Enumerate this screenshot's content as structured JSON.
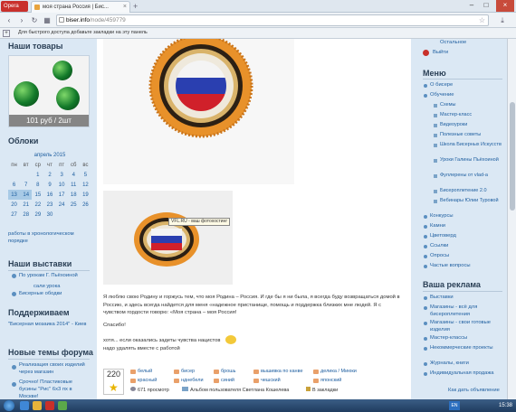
{
  "browser": {
    "opera_label": "Opera",
    "tab_title": "моя страна Россия | Бис...",
    "url_host": "biser.info",
    "url_path": "/node/459779",
    "bookmarks_hint": "Для быстрого доступа добавьте закладки на эту панель"
  },
  "left": {
    "products_title": "Наши товары",
    "product_price": "101 руб / 2шт",
    "calendar_title": "Облоки",
    "calendar_month": "апрель 2015",
    "calendar_days": [
      "пн",
      "вт",
      "ср",
      "чт",
      "пт",
      "сб",
      "вс"
    ],
    "calendar_rows": [
      [
        "",
        "",
        "1",
        "2",
        "3",
        "4",
        "5"
      ],
      [
        "6",
        "7",
        "8",
        "9",
        "10",
        "11",
        "12"
      ],
      [
        "13",
        "14",
        "15",
        "16",
        "17",
        "18",
        "19"
      ],
      [
        "20",
        "21",
        "22",
        "23",
        "24",
        "25",
        "26"
      ],
      [
        "27",
        "28",
        "29",
        "30",
        "",
        "",
        ""
      ]
    ],
    "calendar_link": "работы в хронологическом порядке",
    "exhibitions_title": "Наши выставки",
    "exhibitions": [
      "По урокам Г. Пьёхоиной",
      "сали урока",
      "Бисерные ободки"
    ],
    "support_title": "Поддерживаем",
    "support_text": "\"Бисерная мозаика 2014\" - Киев",
    "forum_title": "Новые темы форума",
    "forum_items": [
      "Реализация своих изделий через магазин",
      "Срочно! Пластиковые бусины \"Рис\" 6х3 пх в Москве!"
    ]
  },
  "main": {
    "tooltip": "VFL.RU - ваш фотохостинг",
    "paragraph1": "Я люблю свою Родину и горжусь тем, что моя Родина – Россия. И где бы я ни была, я всегда буду возвращаться домой в Россию, и здесь всегда найдется для меня «надежное пристанище, помощь и поддержка близких мне людей. Я с чувством гордости говорю: «Моя страна – моя Россия!",
    "paragraph2": "Спасибо!",
    "paragraph3": "хотя... если оказались задеты чувства нацистов",
    "paragraph4": "надо удалять вместе с работой",
    "counter": "220",
    "tags_row1": [
      "белый",
      "бисер",
      "брошь",
      "вышивка по канве",
      "делика / Миюки"
    ],
    "tags_row2": [
      "красный",
      "нднебели",
      "синий",
      "чешский",
      "японский"
    ],
    "views": "671 просмотр",
    "album": "Альбом пользователя Светлана Кошелева",
    "bookmarks_link": "В закладки"
  },
  "right": {
    "top_link": "Остальное",
    "logout": "Выйти",
    "menu_title": "Меню",
    "menu": [
      {
        "label": "О бисере",
        "child": false
      },
      {
        "label": "Обучение",
        "child": false
      },
      {
        "label": "Схемы",
        "child": true
      },
      {
        "label": "Мастер-класс",
        "child": true
      },
      {
        "label": "Видеоуроки",
        "child": true
      },
      {
        "label": "Полезные советы",
        "child": true
      },
      {
        "label": "Школа Бисерных Искусств",
        "child": true
      },
      {
        "label": "Уроки Галины Пьёхоиной",
        "child": true
      },
      {
        "label": "Фуллерены от vlad-a",
        "child": true
      },
      {
        "label": "Бисероплетение 2.0",
        "child": true
      },
      {
        "label": "Вебинары Юлии Туровой",
        "child": true
      },
      {
        "label": "Конкурсы",
        "child": false
      },
      {
        "label": "Камни",
        "child": false
      },
      {
        "label": "Цветоверд",
        "child": false
      },
      {
        "label": "Ссылки",
        "child": false
      },
      {
        "label": "Опросы",
        "child": false
      },
      {
        "label": "Частые вопросы",
        "child": false
      }
    ],
    "ads_title": "Ваша реклама",
    "ads": [
      "Выставки",
      "Магазины - всё для бисероплетения",
      "Магазины - свои готовые изделия",
      "Мастер-классы",
      "Некоммерческие проекты",
      "Журналы, книги",
      "Индивидуальная продажа"
    ],
    "ads_link": "Как дать объявление"
  },
  "taskbar": {
    "lang": "EN",
    "time": "15:38"
  },
  "colors": {
    "accent": "#1f5fa0",
    "page_bg": "#dbe8f4",
    "bead_orange": "#e8912a"
  }
}
